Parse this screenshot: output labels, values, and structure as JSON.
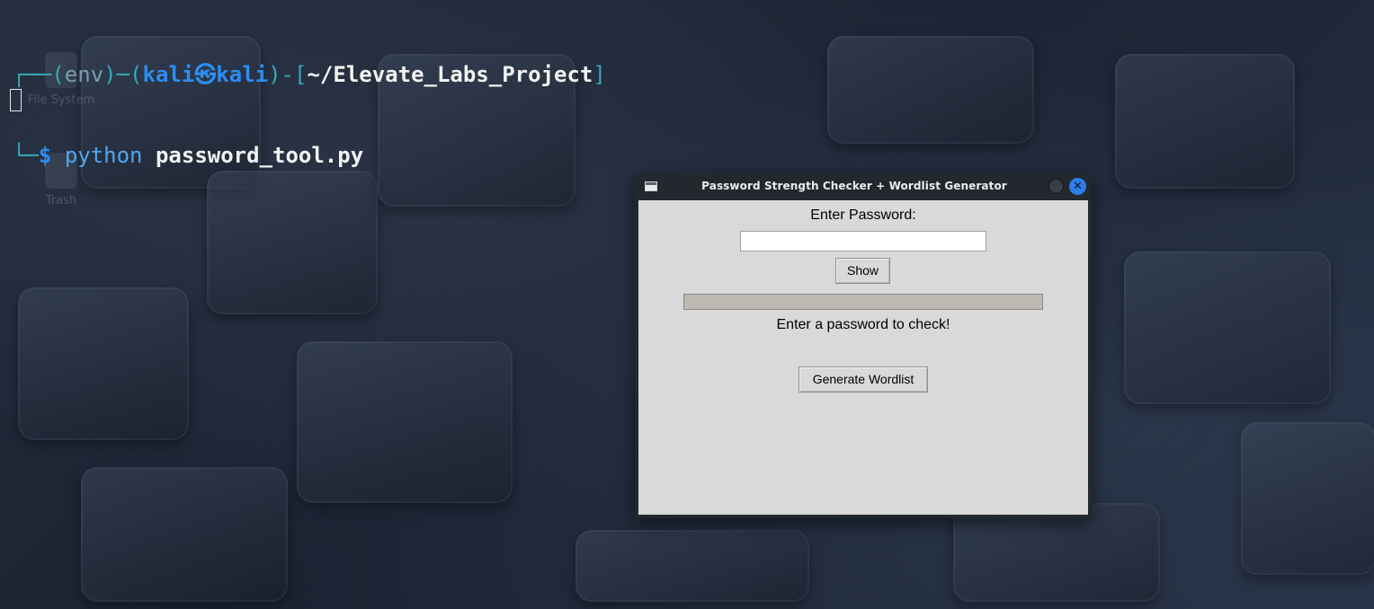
{
  "terminal": {
    "line1": {
      "frame_start": "┌──(",
      "env": "env",
      "frame_mid": ")─(",
      "user": "kali㉿kali",
      "frame_mid2": ")-[",
      "path": "~/Elevate_Labs_Project",
      "frame_end": "]"
    },
    "line2": {
      "frame": "└─",
      "prompt": "$",
      "command": "python",
      "argument": "password_tool.py"
    }
  },
  "desktop": {
    "icons": [
      {
        "label": "File System",
        "icon": "drive-icon"
      },
      {
        "label": "Trash",
        "icon": "trash-icon"
      }
    ]
  },
  "window": {
    "title": "Password Strength Checker + Wordlist Generator",
    "icon": "app-window-icon",
    "close_glyph": "✕",
    "password_label": "Enter Password:",
    "password_value": "",
    "show_button_label": "Show",
    "strength_level": 0,
    "status_message": "Enter a password to check!",
    "generate_button_label": "Generate Wordlist"
  },
  "colors": {
    "accent": "#2f7de8",
    "frame": "#35a9b8",
    "client_bg": "#d9d9d9",
    "bar_bg": "#bdb8b1"
  }
}
